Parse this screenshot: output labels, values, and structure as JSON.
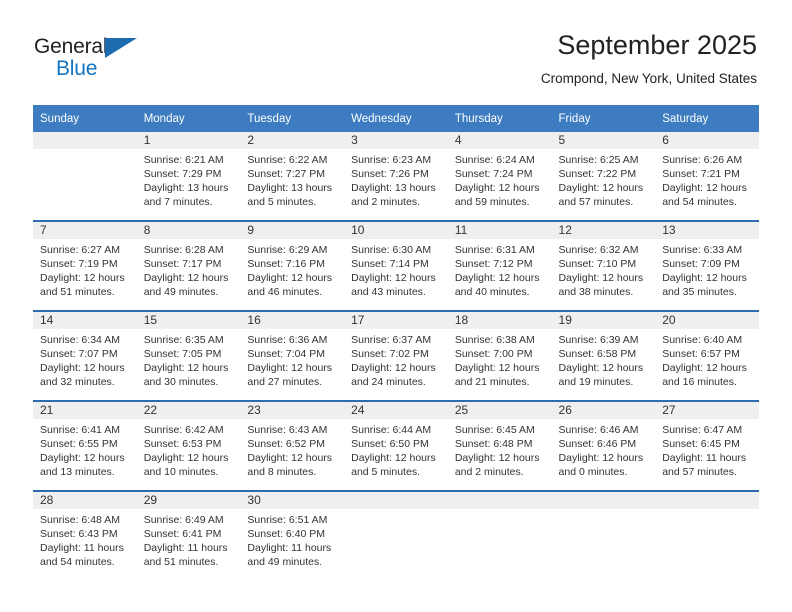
{
  "brand": {
    "name_part1": "General",
    "name_part2": "Blue",
    "triangle_icon": "triangle-icon",
    "accent_color": "#1175c4"
  },
  "header": {
    "title": "September 2025",
    "subtitle": "Crompond, New York, United States",
    "header_bg_color": "#3d7cc0",
    "row_divider_color": "#2d6cae",
    "daynum_band_color": "#efefef"
  },
  "weekdays": [
    "Sunday",
    "Monday",
    "Tuesday",
    "Wednesday",
    "Thursday",
    "Friday",
    "Saturday"
  ],
  "weeks": [
    [
      {
        "day": "",
        "sunrise": "",
        "sunset": "",
        "daylight1": "",
        "daylight2": "",
        "empty": true
      },
      {
        "day": "1",
        "sunrise": "Sunrise: 6:21 AM",
        "sunset": "Sunset: 7:29 PM",
        "daylight1": "Daylight: 13 hours",
        "daylight2": "and 7 minutes."
      },
      {
        "day": "2",
        "sunrise": "Sunrise: 6:22 AM",
        "sunset": "Sunset: 7:27 PM",
        "daylight1": "Daylight: 13 hours",
        "daylight2": "and 5 minutes."
      },
      {
        "day": "3",
        "sunrise": "Sunrise: 6:23 AM",
        "sunset": "Sunset: 7:26 PM",
        "daylight1": "Daylight: 13 hours",
        "daylight2": "and 2 minutes."
      },
      {
        "day": "4",
        "sunrise": "Sunrise: 6:24 AM",
        "sunset": "Sunset: 7:24 PM",
        "daylight1": "Daylight: 12 hours",
        "daylight2": "and 59 minutes."
      },
      {
        "day": "5",
        "sunrise": "Sunrise: 6:25 AM",
        "sunset": "Sunset: 7:22 PM",
        "daylight1": "Daylight: 12 hours",
        "daylight2": "and 57 minutes."
      },
      {
        "day": "6",
        "sunrise": "Sunrise: 6:26 AM",
        "sunset": "Sunset: 7:21 PM",
        "daylight1": "Daylight: 12 hours",
        "daylight2": "and 54 minutes."
      }
    ],
    [
      {
        "day": "7",
        "sunrise": "Sunrise: 6:27 AM",
        "sunset": "Sunset: 7:19 PM",
        "daylight1": "Daylight: 12 hours",
        "daylight2": "and 51 minutes."
      },
      {
        "day": "8",
        "sunrise": "Sunrise: 6:28 AM",
        "sunset": "Sunset: 7:17 PM",
        "daylight1": "Daylight: 12 hours",
        "daylight2": "and 49 minutes."
      },
      {
        "day": "9",
        "sunrise": "Sunrise: 6:29 AM",
        "sunset": "Sunset: 7:16 PM",
        "daylight1": "Daylight: 12 hours",
        "daylight2": "and 46 minutes."
      },
      {
        "day": "10",
        "sunrise": "Sunrise: 6:30 AM",
        "sunset": "Sunset: 7:14 PM",
        "daylight1": "Daylight: 12 hours",
        "daylight2": "and 43 minutes."
      },
      {
        "day": "11",
        "sunrise": "Sunrise: 6:31 AM",
        "sunset": "Sunset: 7:12 PM",
        "daylight1": "Daylight: 12 hours",
        "daylight2": "and 40 minutes."
      },
      {
        "day": "12",
        "sunrise": "Sunrise: 6:32 AM",
        "sunset": "Sunset: 7:10 PM",
        "daylight1": "Daylight: 12 hours",
        "daylight2": "and 38 minutes."
      },
      {
        "day": "13",
        "sunrise": "Sunrise: 6:33 AM",
        "sunset": "Sunset: 7:09 PM",
        "daylight1": "Daylight: 12 hours",
        "daylight2": "and 35 minutes."
      }
    ],
    [
      {
        "day": "14",
        "sunrise": "Sunrise: 6:34 AM",
        "sunset": "Sunset: 7:07 PM",
        "daylight1": "Daylight: 12 hours",
        "daylight2": "and 32 minutes."
      },
      {
        "day": "15",
        "sunrise": "Sunrise: 6:35 AM",
        "sunset": "Sunset: 7:05 PM",
        "daylight1": "Daylight: 12 hours",
        "daylight2": "and 30 minutes."
      },
      {
        "day": "16",
        "sunrise": "Sunrise: 6:36 AM",
        "sunset": "Sunset: 7:04 PM",
        "daylight1": "Daylight: 12 hours",
        "daylight2": "and 27 minutes."
      },
      {
        "day": "17",
        "sunrise": "Sunrise: 6:37 AM",
        "sunset": "Sunset: 7:02 PM",
        "daylight1": "Daylight: 12 hours",
        "daylight2": "and 24 minutes."
      },
      {
        "day": "18",
        "sunrise": "Sunrise: 6:38 AM",
        "sunset": "Sunset: 7:00 PM",
        "daylight1": "Daylight: 12 hours",
        "daylight2": "and 21 minutes."
      },
      {
        "day": "19",
        "sunrise": "Sunrise: 6:39 AM",
        "sunset": "Sunset: 6:58 PM",
        "daylight1": "Daylight: 12 hours",
        "daylight2": "and 19 minutes."
      },
      {
        "day": "20",
        "sunrise": "Sunrise: 6:40 AM",
        "sunset": "Sunset: 6:57 PM",
        "daylight1": "Daylight: 12 hours",
        "daylight2": "and 16 minutes."
      }
    ],
    [
      {
        "day": "21",
        "sunrise": "Sunrise: 6:41 AM",
        "sunset": "Sunset: 6:55 PM",
        "daylight1": "Daylight: 12 hours",
        "daylight2": "and 13 minutes."
      },
      {
        "day": "22",
        "sunrise": "Sunrise: 6:42 AM",
        "sunset": "Sunset: 6:53 PM",
        "daylight1": "Daylight: 12 hours",
        "daylight2": "and 10 minutes."
      },
      {
        "day": "23",
        "sunrise": "Sunrise: 6:43 AM",
        "sunset": "Sunset: 6:52 PM",
        "daylight1": "Daylight: 12 hours",
        "daylight2": "and 8 minutes."
      },
      {
        "day": "24",
        "sunrise": "Sunrise: 6:44 AM",
        "sunset": "Sunset: 6:50 PM",
        "daylight1": "Daylight: 12 hours",
        "daylight2": "and 5 minutes."
      },
      {
        "day": "25",
        "sunrise": "Sunrise: 6:45 AM",
        "sunset": "Sunset: 6:48 PM",
        "daylight1": "Daylight: 12 hours",
        "daylight2": "and 2 minutes."
      },
      {
        "day": "26",
        "sunrise": "Sunrise: 6:46 AM",
        "sunset": "Sunset: 6:46 PM",
        "daylight1": "Daylight: 12 hours",
        "daylight2": "and 0 minutes."
      },
      {
        "day": "27",
        "sunrise": "Sunrise: 6:47 AM",
        "sunset": "Sunset: 6:45 PM",
        "daylight1": "Daylight: 11 hours",
        "daylight2": "and 57 minutes."
      }
    ],
    [
      {
        "day": "28",
        "sunrise": "Sunrise: 6:48 AM",
        "sunset": "Sunset: 6:43 PM",
        "daylight1": "Daylight: 11 hours",
        "daylight2": "and 54 minutes."
      },
      {
        "day": "29",
        "sunrise": "Sunrise: 6:49 AM",
        "sunset": "Sunset: 6:41 PM",
        "daylight1": "Daylight: 11 hours",
        "daylight2": "and 51 minutes."
      },
      {
        "day": "30",
        "sunrise": "Sunrise: 6:51 AM",
        "sunset": "Sunset: 6:40 PM",
        "daylight1": "Daylight: 11 hours",
        "daylight2": "and 49 minutes."
      },
      {
        "day": "",
        "sunrise": "",
        "sunset": "",
        "daylight1": "",
        "daylight2": "",
        "empty": true
      },
      {
        "day": "",
        "sunrise": "",
        "sunset": "",
        "daylight1": "",
        "daylight2": "",
        "empty": true
      },
      {
        "day": "",
        "sunrise": "",
        "sunset": "",
        "daylight1": "",
        "daylight2": "",
        "empty": true
      },
      {
        "day": "",
        "sunrise": "",
        "sunset": "",
        "daylight1": "",
        "daylight2": "",
        "empty": true
      }
    ]
  ]
}
